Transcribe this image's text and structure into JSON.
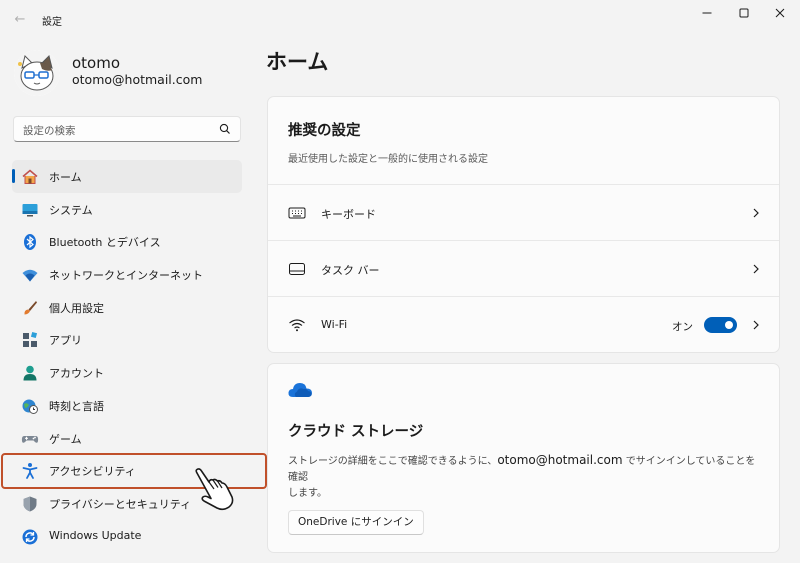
{
  "window": {
    "title": "設定",
    "back_label": "←",
    "controls": [
      "minimize",
      "maximize",
      "close"
    ]
  },
  "profile": {
    "name": "otomo",
    "email": "otomo@hotmail.com"
  },
  "search": {
    "placeholder": "設定の検索"
  },
  "nav": {
    "items": [
      {
        "label": "ホーム",
        "icon": "home-icon",
        "selected": true
      },
      {
        "label": "システム",
        "icon": "monitor-icon",
        "selected": false
      },
      {
        "label": "Bluetooth とデバイス",
        "icon": "bluetooth-icon",
        "selected": false
      },
      {
        "label": "ネットワークとインターネット",
        "icon": "wifi-icon",
        "selected": false
      },
      {
        "label": "個人用設定",
        "icon": "brush-icon",
        "selected": false
      },
      {
        "label": "アプリ",
        "icon": "apps-icon",
        "selected": false
      },
      {
        "label": "アカウント",
        "icon": "person-icon",
        "selected": false
      },
      {
        "label": "時刻と言語",
        "icon": "globe-clock-icon",
        "selected": false
      },
      {
        "label": "ゲーム",
        "icon": "gamepad-icon",
        "selected": false
      },
      {
        "label": "アクセシビリティ",
        "icon": "accessibility-icon",
        "selected": false
      },
      {
        "label": "プライバシーとセキュリティ",
        "icon": "shield-icon",
        "selected": false
      },
      {
        "label": "Windows Update",
        "icon": "update-icon",
        "selected": false
      }
    ]
  },
  "main": {
    "title": "ホーム",
    "recommended": {
      "title": "推奨の設定",
      "subtitle": "最近使用した設定と一般的に使用される設定",
      "rows": [
        {
          "label": "キーボード",
          "icon": "keyboard-icon"
        },
        {
          "label": "タスク バー",
          "icon": "taskbar-icon"
        },
        {
          "label": "Wi-Fi",
          "icon": "wifi-icon",
          "state": "オン",
          "toggle_on": true
        }
      ]
    },
    "cloud": {
      "icon": "cloud-icon",
      "title": "クラウド ストレージ",
      "desc_before": "ストレージの詳細をここで確認できるように、",
      "desc_email": "otomo@hotmail.com",
      "desc_after": " でサインインしていることを確認",
      "desc_end": "します。",
      "button": "OneDrive にサインイン"
    }
  },
  "colors": {
    "accent": "#005fb8",
    "highlight": "#c0502a",
    "background": "#f3f3f3"
  }
}
